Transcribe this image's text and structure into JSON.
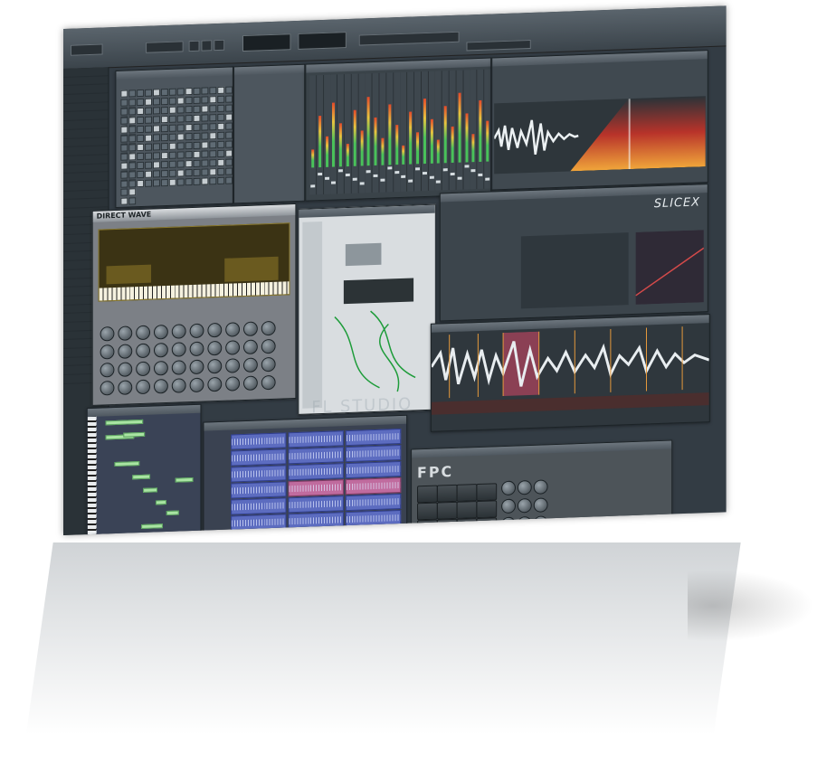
{
  "brand": {
    "directwave_logo": "DIRECT WAVE",
    "slicex_logo": "SLICEX",
    "fpc_logo": "FPC",
    "watermark": "FL STUDIO"
  },
  "colors": {
    "meter_top": "#e34a2a",
    "meter_mid": "#e7c43f",
    "meter_low": "#49c25a",
    "active_pad": "#8ff0ee",
    "clip_blue": "#5c6cc0",
    "clip_pink": "#c06b9e",
    "note_green": "#a9e4a3"
  },
  "icons": [
    "playlist-icon",
    "piano-roll-icon",
    "mixer-icon",
    "channel-rack-icon",
    "browser-icon"
  ]
}
